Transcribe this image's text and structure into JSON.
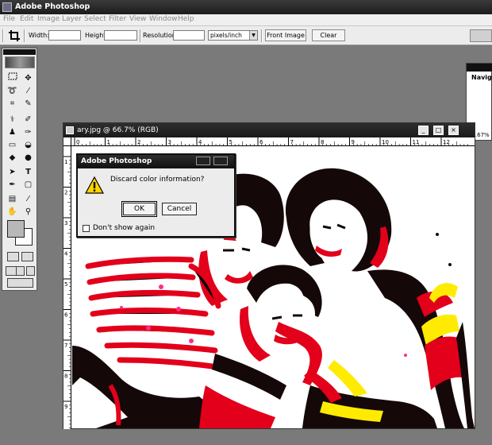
{
  "app": {
    "title": "Adobe Photoshop"
  },
  "menu": [
    "File",
    "Edit",
    "Image",
    "Layer",
    "Select",
    "Filter",
    "View",
    "Window",
    "Help"
  ],
  "options": {
    "width_label": "Width:",
    "height_label": "Height:",
    "resolution_label": "Resolution:",
    "units_value": "pixels/inch",
    "front_image_label": "Front Image",
    "clear_label": "Clear"
  },
  "navigator": {
    "tab_label": "Navig",
    "zoom": "66.67%"
  },
  "document": {
    "title": "ary.jpg @ 66.7% (RGB)",
    "ruler_top": [
      "0",
      "1",
      "2",
      "3",
      "4",
      "5",
      "6",
      "7",
      "8",
      "9",
      "10",
      "11",
      "12"
    ],
    "ruler_left": [
      "1",
      "2",
      "3",
      "4",
      "5",
      "6",
      "7",
      "8",
      "9"
    ]
  },
  "dialog": {
    "title": "Adobe Photoshop",
    "message": "Discard color information?",
    "ok_label": "OK",
    "cancel_label": "Cancel",
    "dont_show_label": "Don't show again",
    "dont_show_checked": false
  }
}
